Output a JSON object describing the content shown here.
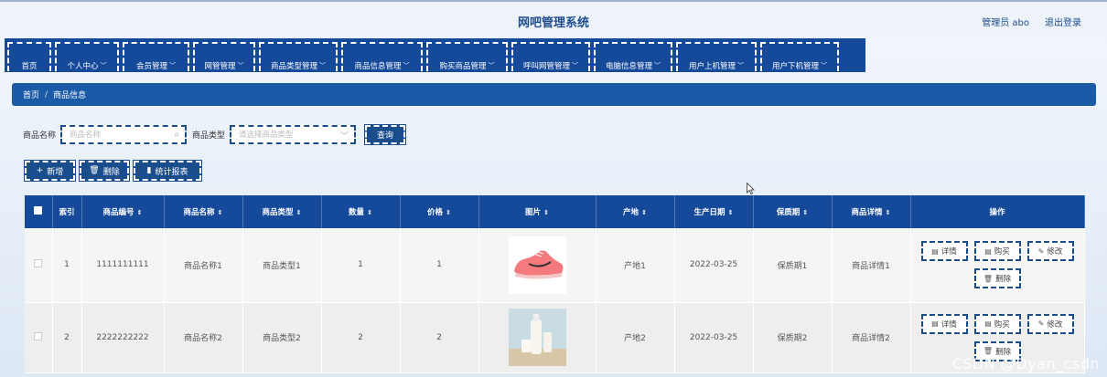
{
  "header": {
    "title": "网吧管理系统",
    "user": "管理员 abo",
    "logout": "退出登录"
  },
  "nav": [
    {
      "label": "首页",
      "chev": false
    },
    {
      "label": "个人中心",
      "chev": true
    },
    {
      "label": "会员管理",
      "chev": true
    },
    {
      "label": "网管管理",
      "chev": true
    },
    {
      "label": "商品类型管理",
      "chev": true
    },
    {
      "label": "商品信息管理",
      "chev": true
    },
    {
      "label": "购买商品管理",
      "chev": true
    },
    {
      "label": "呼叫网管管理",
      "chev": true
    },
    {
      "label": "电脑信息管理",
      "chev": true
    },
    {
      "label": "用户上机管理",
      "chev": true
    },
    {
      "label": "用户下机管理",
      "chev": true
    }
  ],
  "breadcrumb": {
    "home": "首页",
    "sep": "/",
    "current": "商品信息"
  },
  "search": {
    "name_label": "商品名称",
    "name_placeholder": "商品名称",
    "type_label": "商品类型",
    "type_placeholder": "请选择商品类型",
    "query_button": "查询"
  },
  "actions": {
    "add": "新增",
    "delete": "删除",
    "report": "统计报表"
  },
  "table": {
    "columns": [
      "索引",
      "商品编号",
      "商品名称",
      "商品类型",
      "数量",
      "价格",
      "图片",
      "产地",
      "生产日期",
      "保质期",
      "商品详情",
      "操作"
    ],
    "rows": [
      {
        "index": "1",
        "code": "1111111111",
        "name": "商品名称1",
        "type": "商品类型1",
        "qty": "1",
        "price": "1",
        "image": "pink-sneaker",
        "origin": "产地1",
        "date": "2022-03-25",
        "shelf": "保质期1",
        "detail": "商品详情1"
      },
      {
        "index": "2",
        "code": "2222222222",
        "name": "商品名称2",
        "type": "商品类型2",
        "qty": "2",
        "price": "2",
        "image": "milk-bottles",
        "origin": "产地2",
        "date": "2022-03-25",
        "shelf": "保质期2",
        "detail": "商品详情2"
      }
    ],
    "ops": {
      "detail": "详情",
      "buy": "购买",
      "edit": "修改",
      "delete": "删除"
    }
  },
  "watermark": "CSDN @Dyan_csdn",
  "colors": {
    "primary": "#15499a",
    "crumb": "#1a5aa6",
    "title": "#1d4c8a"
  }
}
